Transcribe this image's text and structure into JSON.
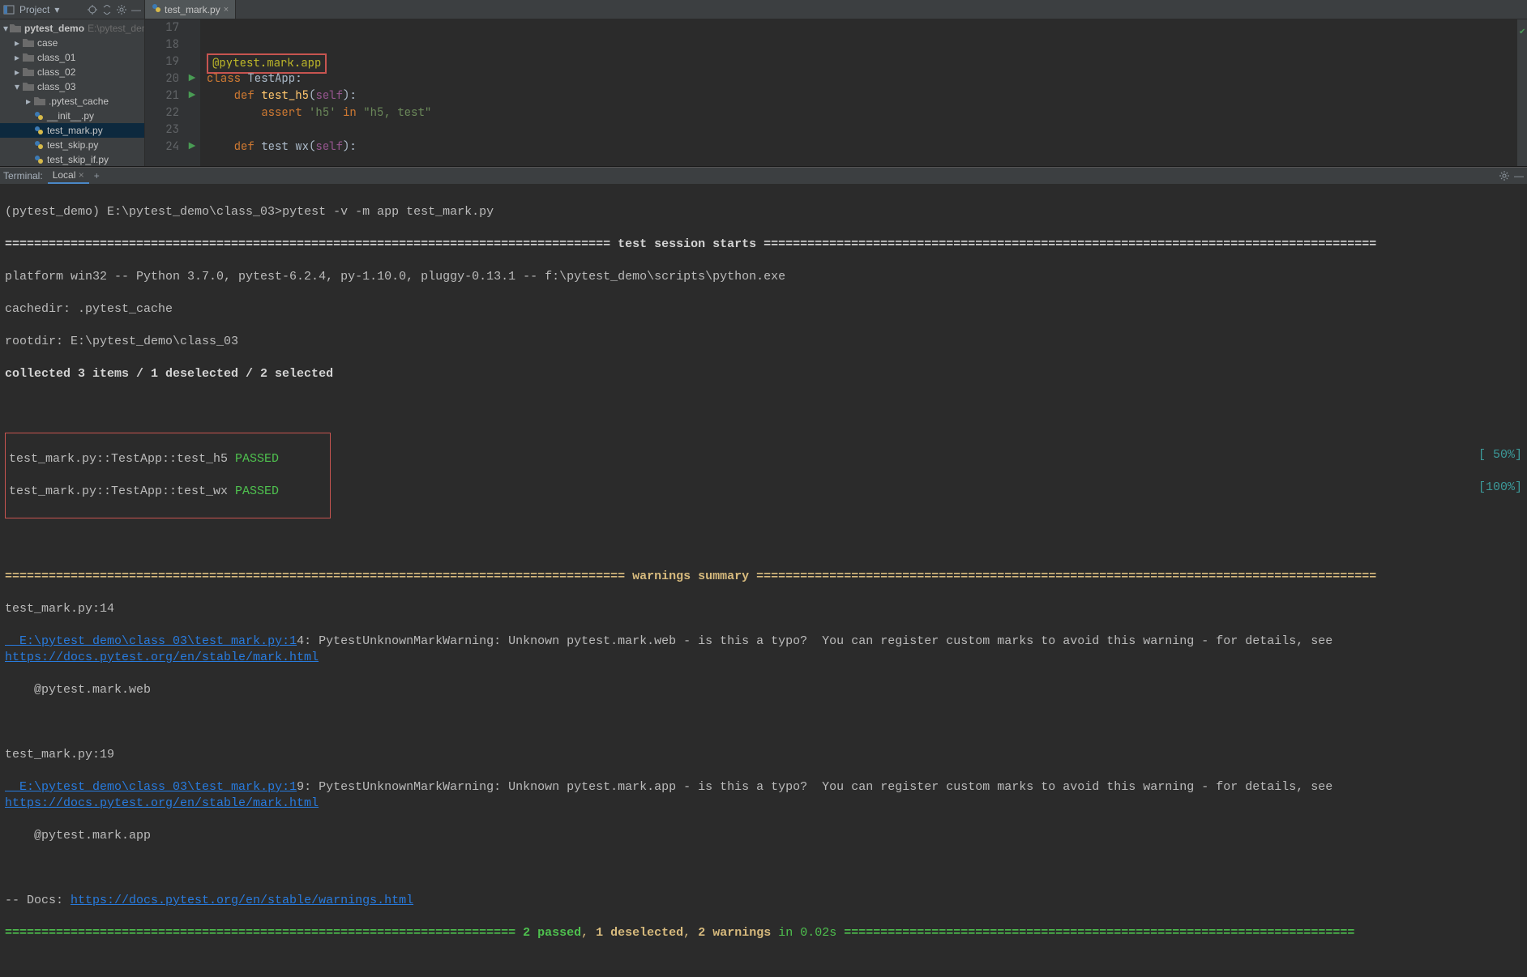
{
  "sidebar": {
    "title": "Project",
    "root": {
      "name": "pytest_demo",
      "path": "E:\\pytest_dem"
    },
    "tree": [
      {
        "label": "case",
        "type": "folder",
        "depth": 1
      },
      {
        "label": "class_01",
        "type": "folder",
        "depth": 1
      },
      {
        "label": "class_02",
        "type": "folder",
        "depth": 1
      },
      {
        "label": "class_03",
        "type": "folder",
        "depth": 1,
        "expanded": true
      },
      {
        "label": ".pytest_cache",
        "type": "folder",
        "depth": 2
      },
      {
        "label": "__init__.py",
        "type": "pyfile",
        "depth": 2
      },
      {
        "label": "test_mark.py",
        "type": "pyfile",
        "depth": 2,
        "selected": true
      },
      {
        "label": "test_skip.py",
        "type": "pyfile",
        "depth": 2
      },
      {
        "label": "test_skip_if.py",
        "type": "pyfile",
        "depth": 2
      }
    ]
  },
  "editor": {
    "tab": "test_mark.py",
    "startLine": 17,
    "lines": [
      {
        "n": 17,
        "html": ""
      },
      {
        "n": 18,
        "html": ""
      },
      {
        "n": 19,
        "html": "<span class=\"decorator-box\"><span class=\"kw-decorator\">@pytest.mark.app</span></span>"
      },
      {
        "n": 20,
        "html": "<span class=\"kw-orange\">class</span> TestApp:",
        "run": true
      },
      {
        "n": 21,
        "html": "    <span class=\"kw-orange\">def</span> <span class=\"fn-name\">test_h5</span>(<span class=\"param-self\">self</span>):",
        "run": true
      },
      {
        "n": 22,
        "html": "        <span class=\"kw-orange\">assert</span> <span class=\"str\">'h5'</span> <span class=\"kw-orange\">in</span> <span class=\"str\">\"h5, test\"</span>"
      },
      {
        "n": 23,
        "html": ""
      },
      {
        "n": 24,
        "html": "    <span class=\"kw-orange\">def</span> test wx(<span class=\"param-self\">self</span>):",
        "run": true
      }
    ]
  },
  "terminal": {
    "title": "Terminal:",
    "tab": "Local",
    "prompt": "(pytest_demo) E:\\pytest_demo\\class_03>",
    "command": "pytest -v -m app test_mark.py",
    "sessionStarts": "test session starts",
    "platform": "platform win32 -- Python 3.7.0, pytest-6.2.4, py-1.10.0, pluggy-0.13.1 -- f:\\pytest_demo\\scripts\\python.exe",
    "cachedir": "cachedir: .pytest_cache",
    "rootdir": "rootdir: E:\\pytest_demo\\class_03",
    "collected": "collected 3 items / 1 deselected / 2 selected",
    "results": [
      {
        "name": "test_mark.py::TestApp::test_h5 ",
        "status": "PASSED",
        "progress": "[ 50%]"
      },
      {
        "name": "test_mark.py::TestApp::test_wx ",
        "status": "PASSED",
        "progress": "[100%]"
      }
    ],
    "warningsTitle": "warnings summary",
    "warning1": {
      "loc": "test_mark.py:14",
      "file": "  E:\\pytest_demo\\class_03\\test_mark.py:1",
      "filetail": "4: PytestUnknownMarkWarning: Unknown pytest.mark.web - is this a typo?  You can register custom marks to avoid this warning - for details, see ",
      "link": "https://docs.pytest.org/en/stable/mark.html",
      "snippet": "    @pytest.mark.web"
    },
    "warning2": {
      "loc": "test_mark.py:19",
      "file": "  E:\\pytest_demo\\class_03\\test_mark.py:1",
      "filetail": "9: PytestUnknownMarkWarning: Unknown pytest.mark.app - is this a typo?  You can register custom marks to avoid this warning - for details, see ",
      "link": "https://docs.pytest.org/en/stable/mark.html",
      "snippet": "    @pytest.mark.app"
    },
    "docsLabel": "-- Docs: ",
    "docsLink": "https://docs.pytest.org/en/stable/warnings.html",
    "summary": {
      "passed": "2 passed",
      "deselected": "1 deselected",
      "warnings": "2 warnings",
      "time": "in 0.02s"
    }
  }
}
